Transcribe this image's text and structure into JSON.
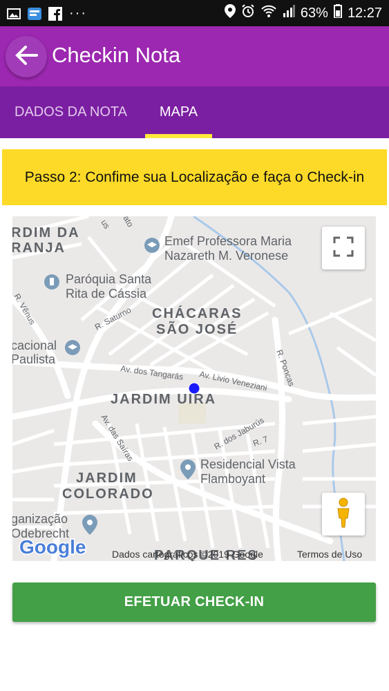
{
  "status_bar": {
    "battery": "63%",
    "time": "12:27"
  },
  "app_bar": {
    "title": "Checkin Nota"
  },
  "tabs": [
    {
      "label": "DADOS DA NOTA",
      "active": false
    },
    {
      "label": "MAPA",
      "active": true
    }
  ],
  "banner": {
    "text": "Passo 2: Confime sua Localização e faça o Check-in"
  },
  "map": {
    "neighborhoods": [
      "RDIM DA",
      "RANJA",
      "CHÁCARAS",
      "SÃO JOSÉ",
      "JARDIM UIRA",
      "JARDIM",
      "COLORADO",
      "PARQUE RES"
    ],
    "places": [
      {
        "line1": "Emef Professora Maria",
        "line2": "Nazareth M. Veronese",
        "icon": "school-icon"
      },
      {
        "line1": "Paróquia Santa",
        "line2": "Rita de Cássia",
        "icon": "church-icon"
      },
      {
        "line1": "cacional",
        "line2": "Paulista",
        "icon": "school-icon"
      },
      {
        "line1": "Residencial Vista",
        "line2": "Flamboyant",
        "icon": "place-pin-icon"
      },
      {
        "line1": "ganização",
        "line2": "Odebrecht",
        "icon": "place-pin-icon"
      }
    ],
    "streets": [
      "R. Vênus",
      "R. Saturno",
      "Av. dos Tangarás",
      "Av. Livio Veneziani",
      "R. Poncas",
      "Av. das Saíras",
      "R. dos Jaburús",
      "R. 7",
      "us",
      "ato"
    ],
    "google_logo": "Google",
    "attribution": "Dados cartográficos ©2019 Google",
    "terms": "Termos de Uso"
  },
  "checkin_button": {
    "label": "EFETUAR CHECK-IN"
  },
  "colors": {
    "app_bar": "#9c27b0",
    "tabs_bg": "#7b1fa2",
    "tab_indicator": "#ffeb3b",
    "banner": "#fdda28",
    "checkin_button": "#43a047",
    "location_dot": "#1a1aff"
  }
}
